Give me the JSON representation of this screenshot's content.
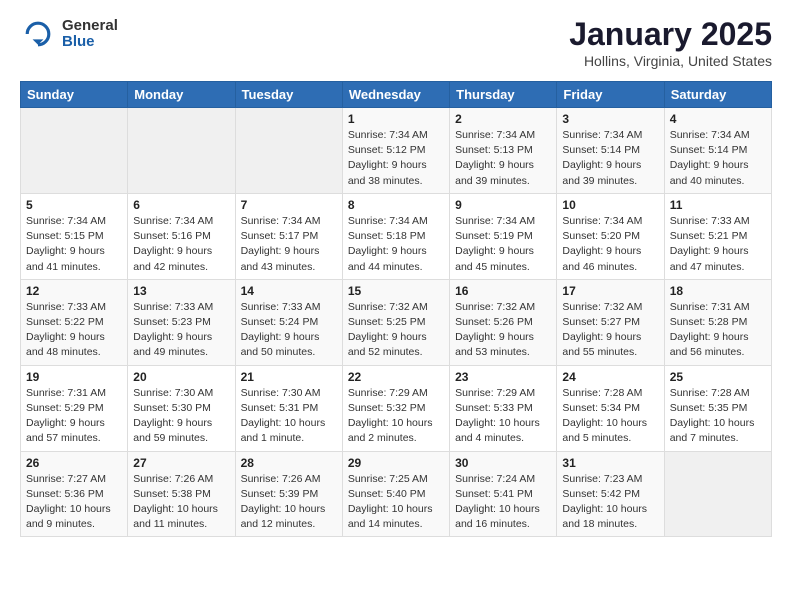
{
  "header": {
    "logo_general": "General",
    "logo_blue": "Blue",
    "month_title": "January 2025",
    "location": "Hollins, Virginia, United States"
  },
  "days_of_week": [
    "Sunday",
    "Monday",
    "Tuesday",
    "Wednesday",
    "Thursday",
    "Friday",
    "Saturday"
  ],
  "weeks": [
    [
      {
        "num": "",
        "info": ""
      },
      {
        "num": "",
        "info": ""
      },
      {
        "num": "",
        "info": ""
      },
      {
        "num": "1",
        "info": "Sunrise: 7:34 AM\nSunset: 5:12 PM\nDaylight: 9 hours and 38 minutes."
      },
      {
        "num": "2",
        "info": "Sunrise: 7:34 AM\nSunset: 5:13 PM\nDaylight: 9 hours and 39 minutes."
      },
      {
        "num": "3",
        "info": "Sunrise: 7:34 AM\nSunset: 5:14 PM\nDaylight: 9 hours and 39 minutes."
      },
      {
        "num": "4",
        "info": "Sunrise: 7:34 AM\nSunset: 5:14 PM\nDaylight: 9 hours and 40 minutes."
      }
    ],
    [
      {
        "num": "5",
        "info": "Sunrise: 7:34 AM\nSunset: 5:15 PM\nDaylight: 9 hours and 41 minutes."
      },
      {
        "num": "6",
        "info": "Sunrise: 7:34 AM\nSunset: 5:16 PM\nDaylight: 9 hours and 42 minutes."
      },
      {
        "num": "7",
        "info": "Sunrise: 7:34 AM\nSunset: 5:17 PM\nDaylight: 9 hours and 43 minutes."
      },
      {
        "num": "8",
        "info": "Sunrise: 7:34 AM\nSunset: 5:18 PM\nDaylight: 9 hours and 44 minutes."
      },
      {
        "num": "9",
        "info": "Sunrise: 7:34 AM\nSunset: 5:19 PM\nDaylight: 9 hours and 45 minutes."
      },
      {
        "num": "10",
        "info": "Sunrise: 7:34 AM\nSunset: 5:20 PM\nDaylight: 9 hours and 46 minutes."
      },
      {
        "num": "11",
        "info": "Sunrise: 7:33 AM\nSunset: 5:21 PM\nDaylight: 9 hours and 47 minutes."
      }
    ],
    [
      {
        "num": "12",
        "info": "Sunrise: 7:33 AM\nSunset: 5:22 PM\nDaylight: 9 hours and 48 minutes."
      },
      {
        "num": "13",
        "info": "Sunrise: 7:33 AM\nSunset: 5:23 PM\nDaylight: 9 hours and 49 minutes."
      },
      {
        "num": "14",
        "info": "Sunrise: 7:33 AM\nSunset: 5:24 PM\nDaylight: 9 hours and 50 minutes."
      },
      {
        "num": "15",
        "info": "Sunrise: 7:32 AM\nSunset: 5:25 PM\nDaylight: 9 hours and 52 minutes."
      },
      {
        "num": "16",
        "info": "Sunrise: 7:32 AM\nSunset: 5:26 PM\nDaylight: 9 hours and 53 minutes."
      },
      {
        "num": "17",
        "info": "Sunrise: 7:32 AM\nSunset: 5:27 PM\nDaylight: 9 hours and 55 minutes."
      },
      {
        "num": "18",
        "info": "Sunrise: 7:31 AM\nSunset: 5:28 PM\nDaylight: 9 hours and 56 minutes."
      }
    ],
    [
      {
        "num": "19",
        "info": "Sunrise: 7:31 AM\nSunset: 5:29 PM\nDaylight: 9 hours and 57 minutes."
      },
      {
        "num": "20",
        "info": "Sunrise: 7:30 AM\nSunset: 5:30 PM\nDaylight: 9 hours and 59 minutes."
      },
      {
        "num": "21",
        "info": "Sunrise: 7:30 AM\nSunset: 5:31 PM\nDaylight: 10 hours and 1 minute."
      },
      {
        "num": "22",
        "info": "Sunrise: 7:29 AM\nSunset: 5:32 PM\nDaylight: 10 hours and 2 minutes."
      },
      {
        "num": "23",
        "info": "Sunrise: 7:29 AM\nSunset: 5:33 PM\nDaylight: 10 hours and 4 minutes."
      },
      {
        "num": "24",
        "info": "Sunrise: 7:28 AM\nSunset: 5:34 PM\nDaylight: 10 hours and 5 minutes."
      },
      {
        "num": "25",
        "info": "Sunrise: 7:28 AM\nSunset: 5:35 PM\nDaylight: 10 hours and 7 minutes."
      }
    ],
    [
      {
        "num": "26",
        "info": "Sunrise: 7:27 AM\nSunset: 5:36 PM\nDaylight: 10 hours and 9 minutes."
      },
      {
        "num": "27",
        "info": "Sunrise: 7:26 AM\nSunset: 5:38 PM\nDaylight: 10 hours and 11 minutes."
      },
      {
        "num": "28",
        "info": "Sunrise: 7:26 AM\nSunset: 5:39 PM\nDaylight: 10 hours and 12 minutes."
      },
      {
        "num": "29",
        "info": "Sunrise: 7:25 AM\nSunset: 5:40 PM\nDaylight: 10 hours and 14 minutes."
      },
      {
        "num": "30",
        "info": "Sunrise: 7:24 AM\nSunset: 5:41 PM\nDaylight: 10 hours and 16 minutes."
      },
      {
        "num": "31",
        "info": "Sunrise: 7:23 AM\nSunset: 5:42 PM\nDaylight: 10 hours and 18 minutes."
      },
      {
        "num": "",
        "info": ""
      }
    ]
  ]
}
